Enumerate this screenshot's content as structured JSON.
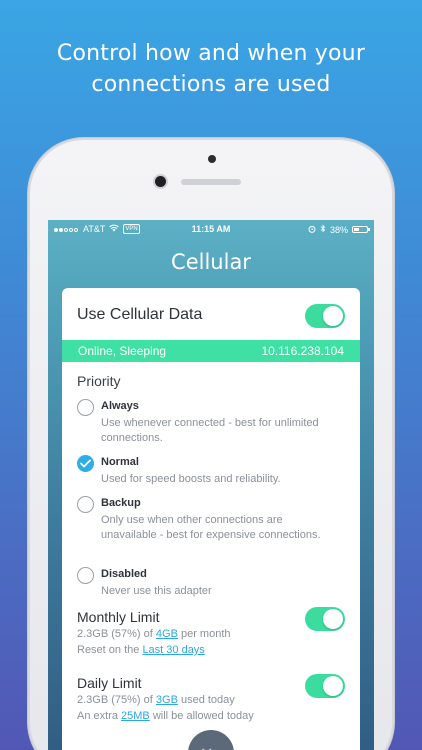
{
  "headline": {
    "line1": "Control how and when your",
    "line2": "connections are used"
  },
  "status_bar": {
    "carrier": "AT&T",
    "vpn": "VPN",
    "time": "11:15 AM",
    "battery": "38%"
  },
  "screen": {
    "title": "Cellular"
  },
  "cellular": {
    "toggle_label": "Use Cellular Data",
    "enabled": true,
    "status_text": "Online, Sleeping",
    "ip": "10.116.238.104"
  },
  "priority": {
    "title": "Priority",
    "options": [
      {
        "label": "Always",
        "desc": "Use whenever connected - best for unlimited connections.",
        "selected": false
      },
      {
        "label": "Normal",
        "desc": "Used for speed boosts and reliability.",
        "selected": true
      },
      {
        "label": "Backup",
        "desc": "Only use when other connections are unavailable - best for expensive connections.",
        "selected": false
      },
      {
        "label": "Disabled",
        "desc": "Never use this adapter",
        "selected": false
      }
    ]
  },
  "monthly_limit": {
    "title": "Monthly Limit",
    "usage_prefix": "2.3GB (57%) of",
    "limit_value": "4GB",
    "usage_suffix": "per month",
    "reset_prefix": "Reset on the",
    "reset_link": "Last 30 days",
    "enabled": true
  },
  "daily_limit": {
    "title": "Daily Limit",
    "usage_prefix": "2.3GB (75%) of",
    "limit_value": "3GB",
    "usage_suffix": "used today",
    "extra_prefix": "An extra",
    "extra_value": "25MB",
    "extra_suffix": "will be allowed today",
    "enabled": true
  },
  "colors": {
    "accent_green": "#3fe0a4",
    "accent_blue": "#2eaee6"
  }
}
